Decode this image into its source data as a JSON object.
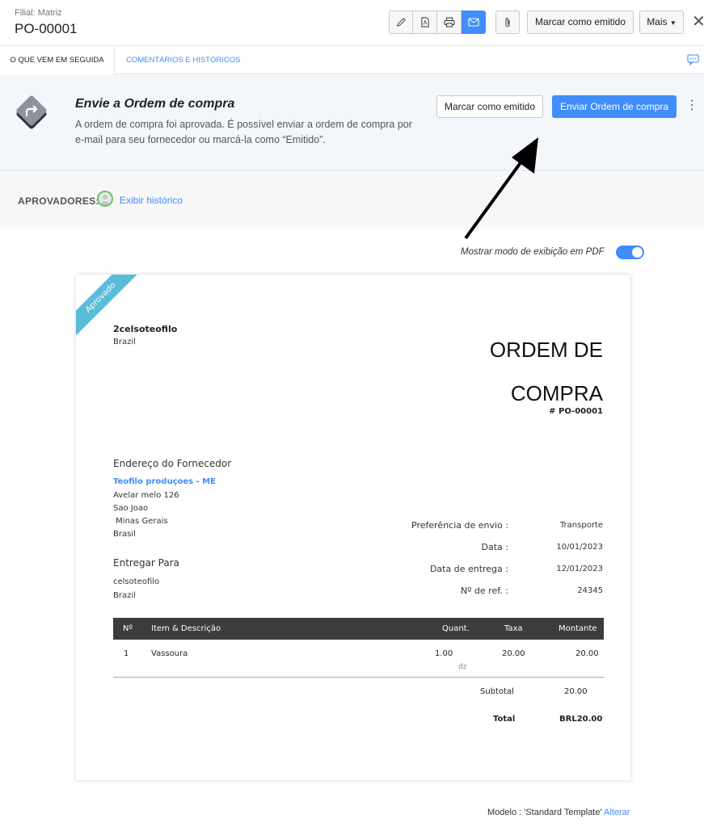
{
  "header": {
    "branch": "Filial: Matriz",
    "po_number": "PO-00001",
    "emit_label": "Marcar como emitido",
    "more_label": "Mais",
    "close_glyph": "✕",
    "toolbar_icons": [
      "pencil-icon",
      "pdf-icon",
      "printer-icon",
      "email-icon"
    ],
    "attach_icon": "paperclip-icon"
  },
  "tabs": [
    {
      "label": "O QUE VEM EM SEGUIDA",
      "active": true
    },
    {
      "label": "COMENTÁRIOS E HISTÓRICOS",
      "active": false
    }
  ],
  "banner": {
    "title": "Envie a Ordem de compra",
    "description": "A ordem de compra foi aprovada. É possível enviar a ordem de compra por e-mail para seu fornecedor ou marcá-la como “Emitido”.",
    "emit_label": "Marcar como emitido",
    "send_label": "Enviar Ordem de compra"
  },
  "approvers": {
    "label": "APROVADORES:",
    "history_link": "Exibir histórico"
  },
  "pdf_toggle": {
    "label": "Mostrar modo de exibição em PDF",
    "on": true
  },
  "document": {
    "ribbon": "Aprovado",
    "company": "2celsoteofilo",
    "company_country": "Brazil",
    "title_line1": "ORDEM DE",
    "title_line2": "COMPRA",
    "number": "# PO-00001",
    "vendor_section": "Endereço do Fornecedor",
    "vendor_name": "Teofilo produçoes - ME",
    "vendor_address": [
      "Avelar melo 126",
      "Sao Joao",
      " Minas Gerais",
      "Brasil"
    ],
    "deliver_section": "Entregar Para",
    "deliver_address": [
      "celsoteofilo",
      "Brazil"
    ],
    "meta": [
      {
        "label": "Preferência de envio :",
        "value": "Transporte"
      },
      {
        "label": "Data :",
        "value": "10/01/2023"
      },
      {
        "label": "Data de entrega :",
        "value": "12/01/2023"
      },
      {
        "label": "Nº de ref. :",
        "value": "24345"
      }
    ],
    "table": {
      "headers": [
        "Nº",
        "Item & Descrição",
        "Quant.",
        "Taxa",
        "Montante"
      ],
      "rows": [
        {
          "num": "1",
          "item": "Vassoura",
          "qty": "1.00",
          "unit": "dz",
          "rate": "20.00",
          "amount": "20.00"
        }
      ]
    },
    "subtotal_label": "Subtotal",
    "subtotal_value": "20.00",
    "total_label": "Total",
    "total_value": "BRL20.00"
  },
  "footer": {
    "template_text": "Modelo : 'Standard Template'",
    "change_link": "Alterar"
  },
  "colors": {
    "accent": "#408dfb",
    "ribbon": "#5bbcd9",
    "table_header": "#3c3d3a"
  }
}
